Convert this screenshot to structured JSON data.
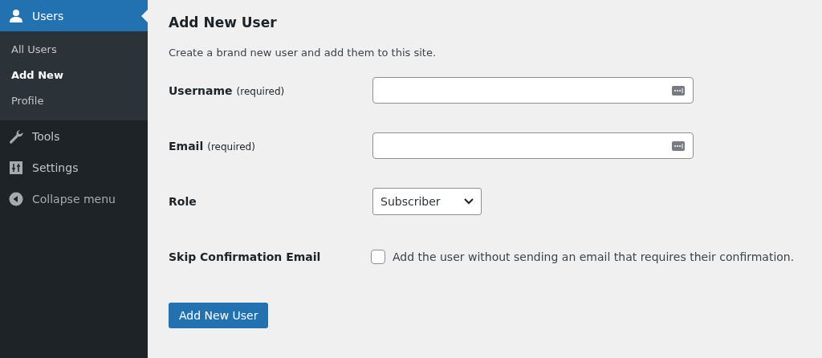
{
  "sidebar": {
    "items": [
      {
        "label": "Users",
        "kind": "menu",
        "selected": true,
        "children": [
          {
            "label": "All Users",
            "selected": false
          },
          {
            "label": "Add New",
            "selected": true
          },
          {
            "label": "Profile",
            "selected": false
          }
        ]
      },
      {
        "label": "Tools",
        "kind": "menu",
        "selected": false
      },
      {
        "label": "Settings",
        "kind": "menu",
        "selected": false
      },
      {
        "label": "Collapse menu",
        "kind": "collapse",
        "selected": false
      }
    ]
  },
  "page": {
    "title": "Add New User",
    "description": "Create a brand new user and add them to this site.",
    "fields": [
      {
        "kind": "text",
        "label": "Username",
        "note": "(required)"
      },
      {
        "kind": "text",
        "label": "Email",
        "note": "(required)"
      },
      {
        "kind": "select",
        "label": "Role",
        "value": "Subscriber"
      },
      {
        "kind": "checkbox",
        "label": "Skip Confirmation Email",
        "text": "Add the user without sending an email that requires their confirmation.",
        "checked": false
      }
    ],
    "submit": "Add New User"
  }
}
